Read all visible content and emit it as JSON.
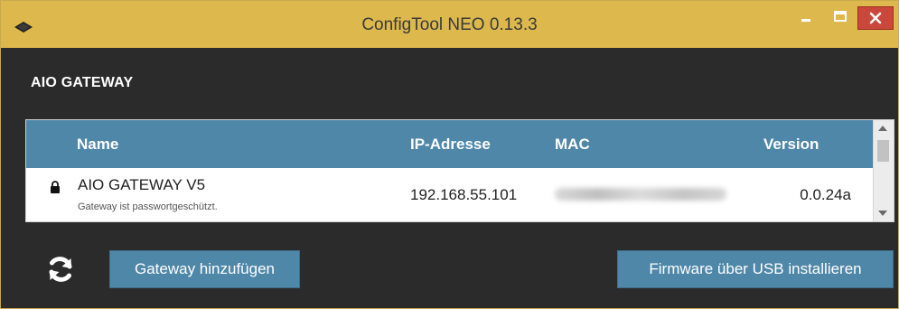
{
  "window": {
    "title": "ConfigTool NEO 0.13.3",
    "accent_color": "#ddb84d",
    "close_color": "#c9483b"
  },
  "section": {
    "title": "AIO GATEWAY"
  },
  "table": {
    "columns": [
      "Name",
      "IP-Adresse",
      "MAC",
      "Version"
    ],
    "header_color": "#4f87a8",
    "rows": [
      {
        "name": "AIO GATEWAY V5",
        "subtitle": "Gateway ist passwortgeschützt.",
        "ip": "192.168.55.101",
        "mac_blurred": true,
        "version": "0.0.24a",
        "locked": true
      }
    ]
  },
  "actions": {
    "refresh_icon": "refresh-icon",
    "add_gateway_label": "Gateway hinzufügen",
    "firmware_usb_label": "Firmware über USB installieren"
  }
}
